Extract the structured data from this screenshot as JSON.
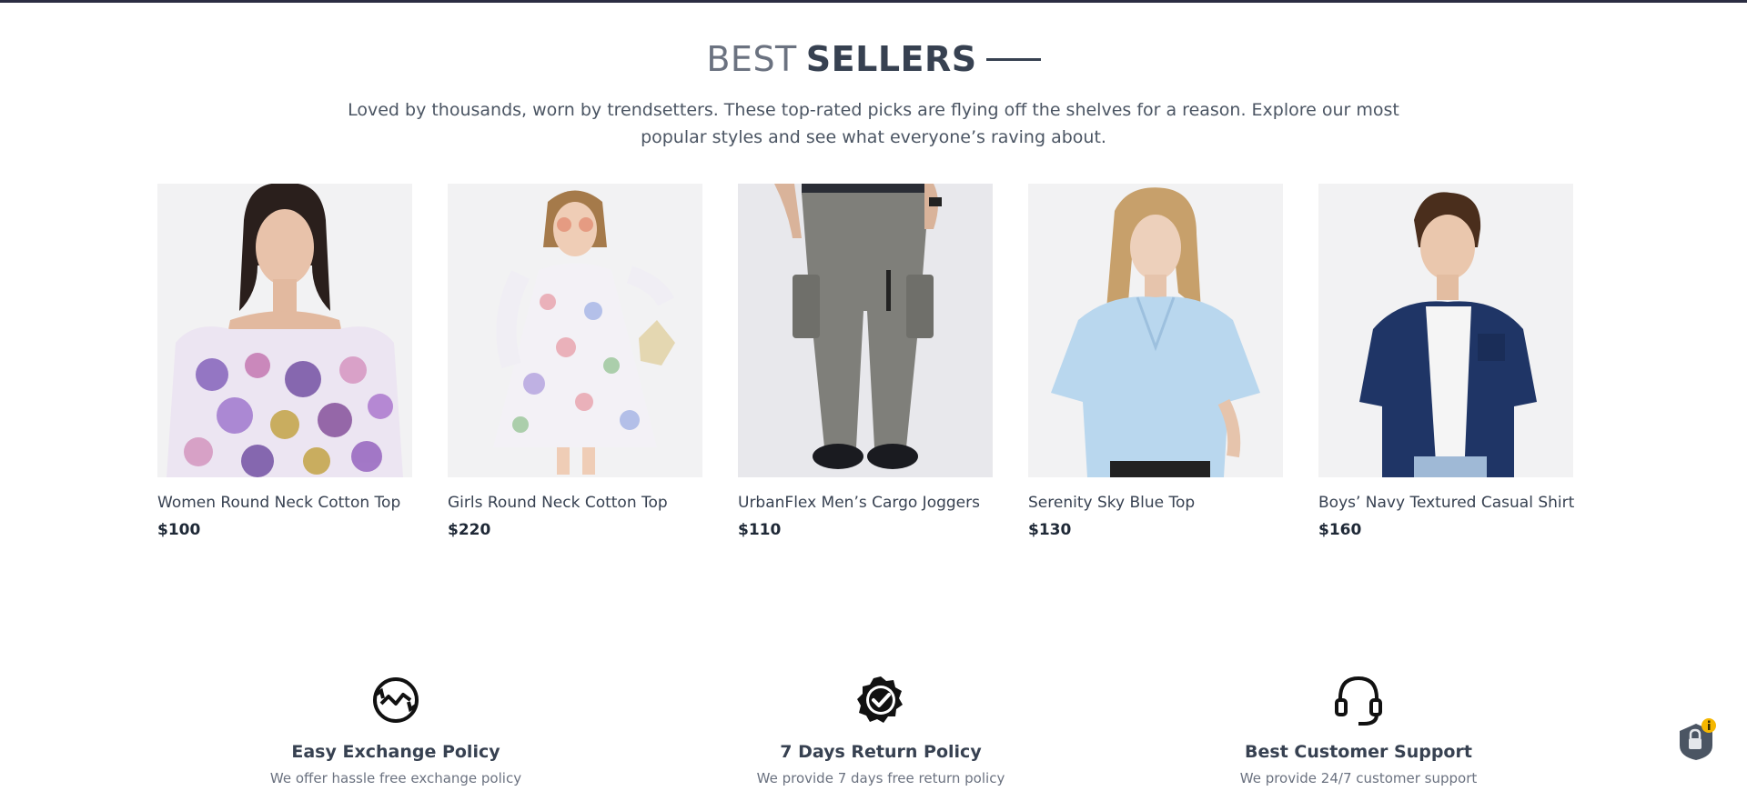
{
  "header": {
    "title_light": "BEST",
    "title_bold": "SELLERS",
    "subtitle": "Loved by thousands, worn by trendsetters. These top-rated picks are flying off the shelves for a reason. Explore our most popular styles and see what everyone’s raving about."
  },
  "products": [
    {
      "name": "Women Round Neck Cotton Top",
      "price": "$100"
    },
    {
      "name": "Girls Round Neck Cotton Top",
      "price": "$220"
    },
    {
      "name": "UrbanFlex Men’s Cargo Joggers",
      "price": "$110"
    },
    {
      "name": "Serenity Sky Blue Top",
      "price": "$130"
    },
    {
      "name": "Boys’ Navy Textured Casual Shirt",
      "price": "$160"
    }
  ],
  "features": [
    {
      "icon": "exchange-icon",
      "title": "Easy Exchange Policy",
      "desc": "We offer hassle free exchange policy"
    },
    {
      "icon": "verified-badge-icon",
      "title": "7 Days Return Policy",
      "desc": "We provide 7 days free return policy"
    },
    {
      "icon": "headset-icon",
      "title": "Best Customer Support",
      "desc": "We provide 24/7 customer support"
    }
  ],
  "colors": {
    "text_dark": "#374151",
    "text_muted": "#6b7280",
    "badge_yellow": "#f5b700",
    "lock_gray": "#4b5563"
  }
}
